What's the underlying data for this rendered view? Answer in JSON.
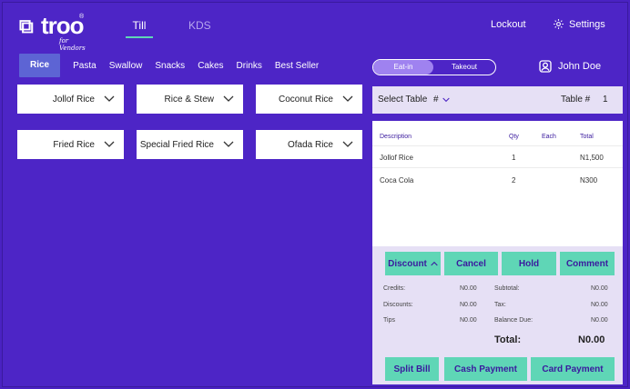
{
  "brand": {
    "logo_text": "troo",
    "registered": "®",
    "tagline": "for Vendors"
  },
  "nav": {
    "tabs": [
      {
        "label": "Till",
        "active": true
      },
      {
        "label": "KDS",
        "active": false
      }
    ],
    "lockout": "Lockout",
    "settings": "Settings"
  },
  "categories": [
    {
      "label": "Rice",
      "active": true
    },
    {
      "label": "Pasta"
    },
    {
      "label": "Swallow"
    },
    {
      "label": "Snacks"
    },
    {
      "label": "Cakes"
    },
    {
      "label": "Drinks"
    },
    {
      "label": "Best Seller"
    }
  ],
  "menu_items": [
    {
      "label": "Jollof Rice"
    },
    {
      "label": "Rice & Stew"
    },
    {
      "label": "Coconut Rice"
    },
    {
      "label": "Fried Rice"
    },
    {
      "label": "Special Fried Rice"
    },
    {
      "label": "Ofada Rice"
    }
  ],
  "order_type": {
    "eat_in": "Eat-in",
    "takeout": "Takeout",
    "selected": "Eat-in"
  },
  "user": {
    "name": "John Doe"
  },
  "table": {
    "select_label": "Select Table",
    "hash_label": "#",
    "table_label": "Table #",
    "table_value": "1"
  },
  "order": {
    "headers": {
      "description": "Description",
      "qty": "Qty",
      "each": "Each",
      "total": "Total"
    },
    "lines": [
      {
        "description": "Jollof Rice",
        "qty": "1",
        "each": "",
        "total": "N1,500"
      },
      {
        "description": "Coca Cola",
        "qty": "2",
        "each": "",
        "total": "N300"
      }
    ]
  },
  "actions": {
    "discount": "Discount",
    "cancel": "Cancel",
    "hold": "Hold",
    "comment": "Comment"
  },
  "totals": {
    "credits_label": "Credits:",
    "credits": "N0.00",
    "discounts_label": "Discounts:",
    "discounts": "N0.00",
    "tips_label": "Tips",
    "tips": "N0.00",
    "subtotal_label": "Subtotal:",
    "subtotal": "N0.00",
    "tax_label": "Tax:",
    "tax": "N0.00",
    "balance_label": "Balance Due:",
    "balance": "N0.00",
    "total_label": "Total:",
    "total": "N0.00"
  },
  "payments": {
    "split": "Split Bill",
    "cash": "Cash Payment",
    "card": "Card Payment"
  },
  "colors": {
    "background": "#4d25c6",
    "accent": "#5fd6b6",
    "panel": "#e6e0f5",
    "active_category": "#5d64d4",
    "text_dark": "#3a1a9e"
  }
}
